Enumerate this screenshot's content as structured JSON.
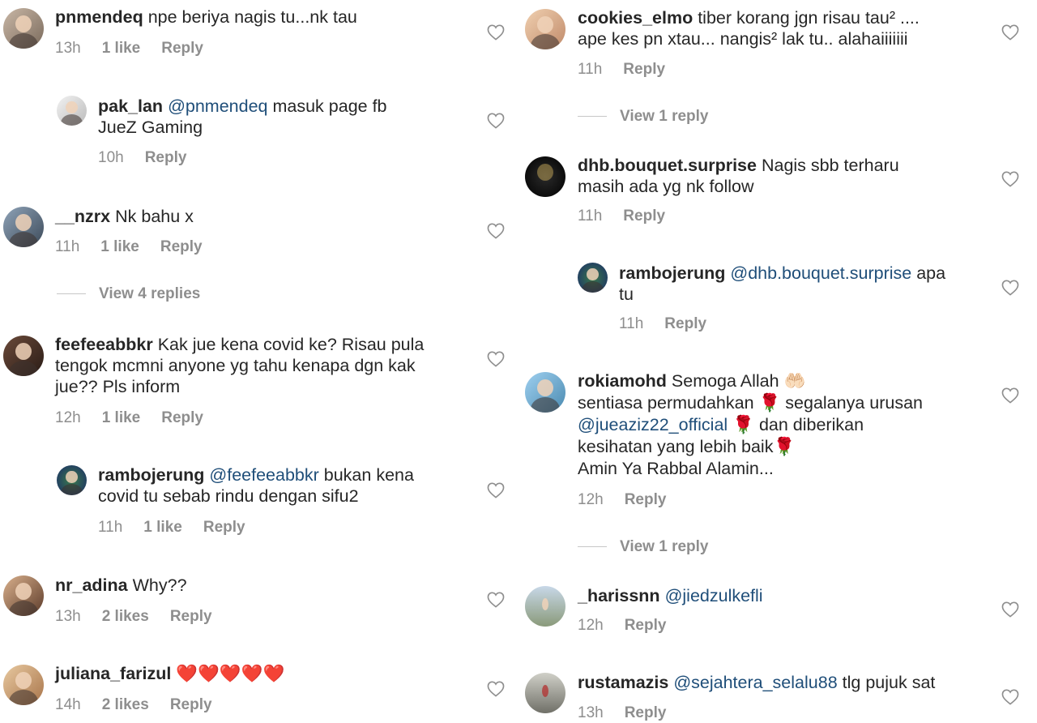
{
  "icons": {
    "like": "heart-outline-icon"
  },
  "left_column": {
    "c1": {
      "username": "pnmendeq",
      "text": "npe beriya nagis tu...nk tau",
      "time": "13h",
      "likes": "1 like",
      "reply": "Reply"
    },
    "c1_reply": {
      "username": "pak_lan",
      "mention": "@pnmendeq",
      "text_line1": "masuk page fb",
      "text_line2": "JueZ Gaming",
      "time": "10h",
      "reply": "Reply"
    },
    "c2": {
      "username": "__nzrx",
      "text": "Nk bahu x",
      "time": "11h",
      "likes": "1 like",
      "reply": "Reply",
      "view_replies": "View 4 replies"
    },
    "c3": {
      "username": "feefeeabbkr",
      "text_line1": "Kak jue kena covid ke? Risau pula",
      "text_line2": "tengok mcmni anyone yg tahu kenapa dgn kak",
      "text_line3": "jue?? Pls inform",
      "time": "12h",
      "likes": "1 like",
      "reply": "Reply"
    },
    "c3_reply": {
      "username": "rambojerung",
      "mention": "@feefeeabbkr",
      "text_line1": "bukan kena",
      "text_line2": "covid tu sebab rindu dengan sifu2",
      "time": "11h",
      "likes": "1 like",
      "reply": "Reply"
    },
    "c4": {
      "username": "nr_adina",
      "text": "Why??",
      "time": "13h",
      "likes": "2 likes",
      "reply": "Reply"
    },
    "c5": {
      "username": "juliana_farizul",
      "hearts": "❤️❤️❤️❤️❤️",
      "time": "14h",
      "likes": "2 likes",
      "reply": "Reply"
    }
  },
  "right_column": {
    "c1": {
      "username": "cookies_elmo",
      "text_line1": "tiber korang jgn risau tau² ....",
      "text_line2": "ape kes pn xtau... nangis² lak tu.. alahaiiiiiii",
      "time": "11h",
      "reply": "Reply",
      "view_replies": "View 1 reply"
    },
    "c2": {
      "username": "dhb.bouquet.surprise",
      "text_line1": "Nagis sbb terharu",
      "text_line2": "masih ada yg nk follow",
      "time": "11h",
      "reply": "Reply"
    },
    "c2_reply": {
      "username": "rambojerung",
      "mention": "@dhb.bouquet.surprise",
      "text_line1": "apa",
      "text_line2": "tu",
      "time": "11h",
      "reply": "Reply"
    },
    "c3": {
      "username": "rokiamohd",
      "text_line1": "Semoga Allah",
      "emoji_hands": "🤲🏻",
      "text_line2": "sentiasa permudahkan",
      "emoji_rose": "🌹",
      "text_line2b": "segalanya urusan",
      "mention": "@jueaziz22_official",
      "text_line3b": "dan diberikan",
      "text_line4": "kesihatan yang lebih baik",
      "text_line5": "Amin Ya Rabbal Alamin...",
      "time": "12h",
      "reply": "Reply",
      "view_replies": "View 1 reply"
    },
    "c4": {
      "username": "_harissnn",
      "mention": "@jiedzulkefli",
      "time": "12h",
      "reply": "Reply"
    },
    "c5": {
      "username": "rustamazis",
      "mention": "@sejahtera_selalu88",
      "text": "tlg pujuk sat",
      "time": "13h",
      "reply": "Reply"
    }
  }
}
